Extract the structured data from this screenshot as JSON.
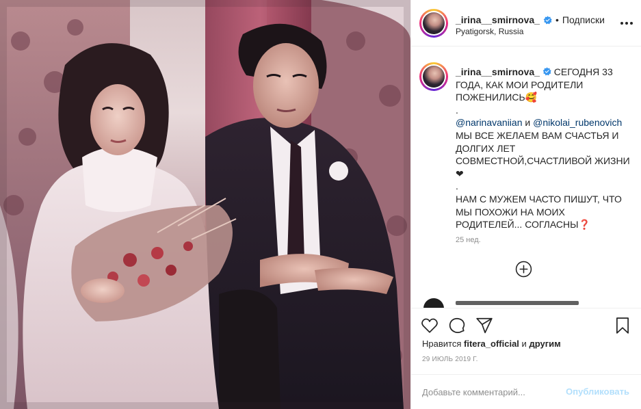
{
  "post": {
    "username": "_irina__smirnova_",
    "separator": "•",
    "follow_label": "Подписки",
    "location": "Pyatigorsk, Russia"
  },
  "caption": {
    "username": "_irina__smirnova_",
    "line1": "СЕГОДНЯ 33 ГОДА, КАК МОИ РОДИТЕЛИ ПОЖЕНИЛИСЬ🥰",
    "dot1": ".",
    "mention1": "@narinavaniian",
    "and": " и ",
    "mention2": "@nikolai_rubenovich",
    "line2": "МЫ ВСЕ ЖЕЛАЕМ ВАМ СЧАСТЬЯ И ДОЛГИХ ЛЕТ СОВМЕСТНОЙ,СЧАСТЛИВОЙ ЖИЗНИ❤",
    "dot2": ".",
    "line3": "НАМ С МУЖЕМ ЧАСТО ПИШУТ, ЧТО МЫ ПОХОЖИ НА МОИХ РОДИТЕЛЕЙ... СОГЛАСНЫ",
    "question": "❓",
    "age": "25 нед."
  },
  "actions": {
    "like_icon": "heart-icon",
    "comment_icon": "comment-icon",
    "share_icon": "paper-plane-icon",
    "save_icon": "bookmark-icon"
  },
  "likes": {
    "prefix": "Нравится",
    "user": "fitera_official",
    "middle": "и",
    "suffix": "другим"
  },
  "date": "29 ИЮЛЬ 2019 Г.",
  "comment_box": {
    "placeholder": "Добавьте комментарий...",
    "publish_label": "Опубликовать"
  },
  "colors": {
    "link": "#00376b",
    "muted": "#8e8e8e",
    "publish_disabled": "#b2dffc",
    "verified": "#3897f0"
  }
}
